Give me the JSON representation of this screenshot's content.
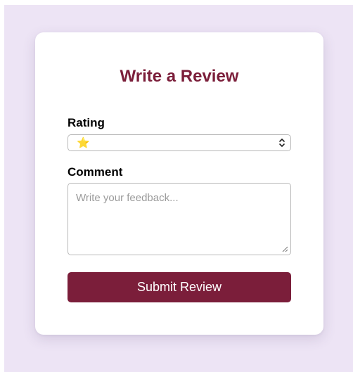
{
  "review_form": {
    "title": "Write a Review",
    "rating": {
      "label": "Rating",
      "selected": "⭐",
      "icon": "chevron-up-down-icon"
    },
    "comment": {
      "label": "Comment",
      "value": "",
      "placeholder": "Write your feedback..."
    },
    "submit_label": "Submit Review"
  },
  "colors": {
    "background": "#ede4f5",
    "card": "#ffffff",
    "accent": "#7b1e3a",
    "star": "#f2b01e"
  }
}
